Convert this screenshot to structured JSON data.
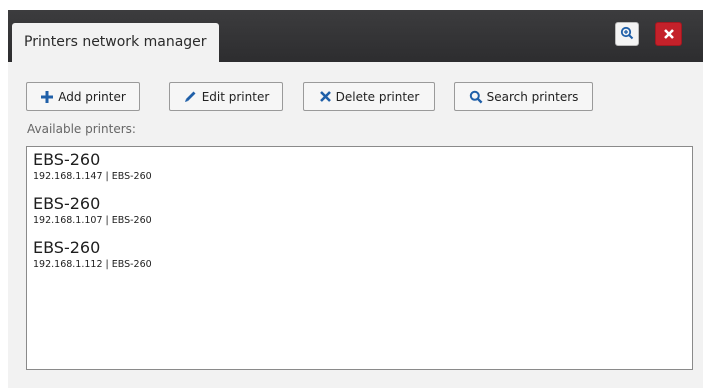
{
  "window": {
    "title": "Printers network manager"
  },
  "titlebar": {
    "zoom_icon": "zoom-in-icon",
    "close_icon": "close-icon"
  },
  "toolbar": {
    "add_label": "Add printer",
    "edit_label": "Edit printer",
    "delete_label": "Delete printer",
    "search_label": "Search printers"
  },
  "list": {
    "label": "Available printers:",
    "items": [
      {
        "name": "EBS-260",
        "detail": "192.168.1.147 | EBS-260"
      },
      {
        "name": "EBS-260",
        "detail": "192.168.1.107 | EBS-260"
      },
      {
        "name": "EBS-260",
        "detail": "192.168.1.112 | EBS-260"
      }
    ]
  },
  "colors": {
    "titlebar": "#333335",
    "close_button": "#c4212a",
    "icon_blue": "#1f5fa8",
    "panel_bg": "#f2f2f2"
  }
}
